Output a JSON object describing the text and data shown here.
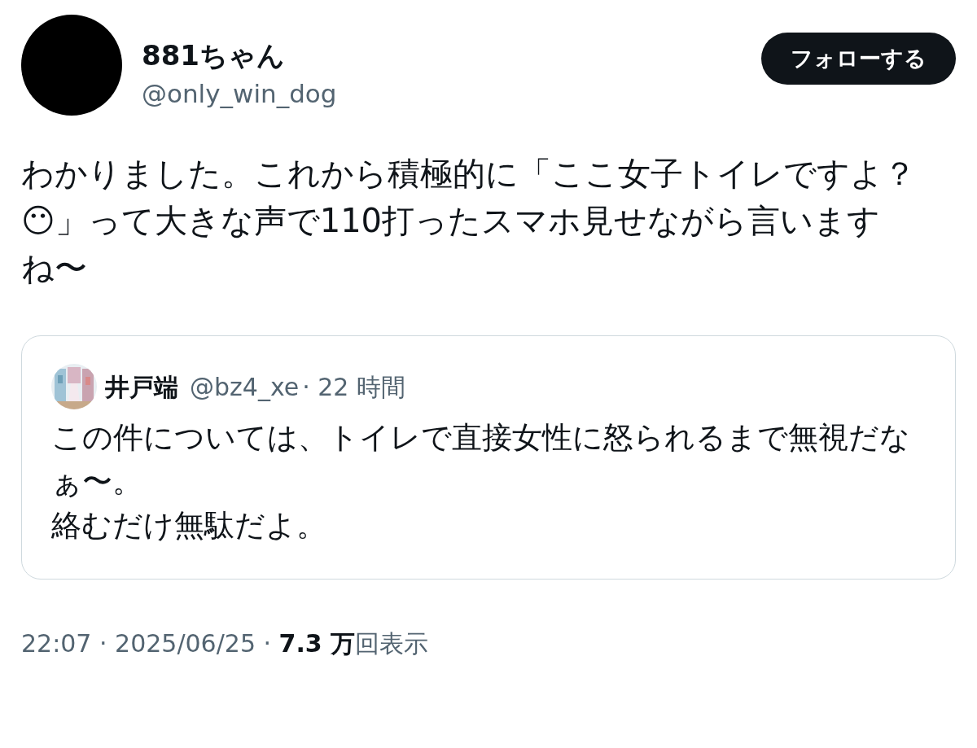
{
  "author": {
    "name": "881ちゃん",
    "handle": "@only_win_dog"
  },
  "follow_button": {
    "label": "フォローする"
  },
  "text": "わかりました。これから積極的に「ここ女子トイレですよ？😶」って大きな声で110打ったスマホ見せながら言いますね〜",
  "quoted": {
    "name": "井戸端",
    "handle": "@bz4_xe",
    "time": "· 22 時間",
    "paragraphs": [
      "この件については、トイレで直接女性に怒られるまで無視だなぁ〜。",
      "絡むだけ無駄だよ。"
    ]
  },
  "footer": "22:07 · 2025/06/25 · **7.3 万**回表示"
}
